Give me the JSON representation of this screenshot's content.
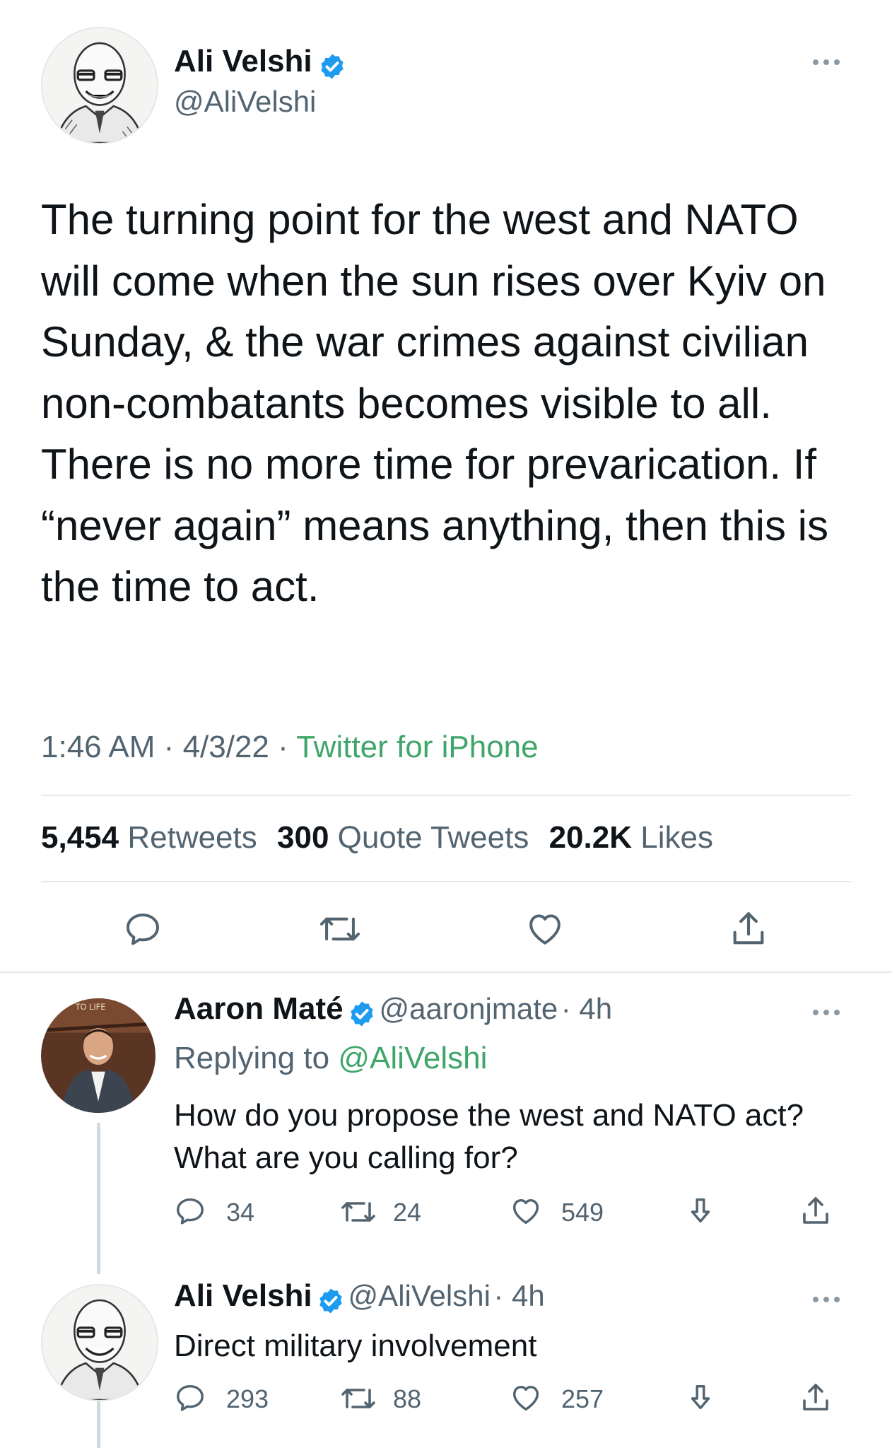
{
  "main_tweet": {
    "name": "Ali Velshi",
    "handle": "@AliVelshi",
    "text": "The turning point for the west and NATO will come when the sun rises over Kyiv on Sunday, & the war crimes against civilian non-combatants becomes visible to all. There is no more time for prevarication. If “never again” means anything, then this is the time to act.",
    "time": "1:46 AM",
    "date": "4/3/22",
    "separator": "·",
    "source": "Twitter for iPhone",
    "stats": {
      "retweets_count": "5,454",
      "retweets_label": "Retweets",
      "quotes_count": "300",
      "quotes_label": "Quote Tweets",
      "likes_count": "20.2K",
      "likes_label": "Likes"
    },
    "actions": [
      "reply-icon",
      "retweet-icon",
      "like-icon",
      "share-icon"
    ]
  },
  "replies": [
    {
      "name": "Aaron Maté",
      "handle": "@aaronjmate",
      "time": "· 4h",
      "replying_prefix": "Replying to",
      "replying_handle": "@AliVelshi",
      "text": "How do you propose the west and NATO act? What are you calling for?",
      "replies": "34",
      "retweets": "24",
      "likes": "549"
    },
    {
      "name": "Ali Velshi",
      "handle": "@AliVelshi",
      "time": "· 4h",
      "text": "Direct military involvement",
      "replies": "293",
      "retweets": "88",
      "likes": "257"
    }
  ],
  "colors": {
    "brand_blue": "#1d9bf0",
    "source_green": "#3fa66a",
    "muted": "#536471"
  }
}
